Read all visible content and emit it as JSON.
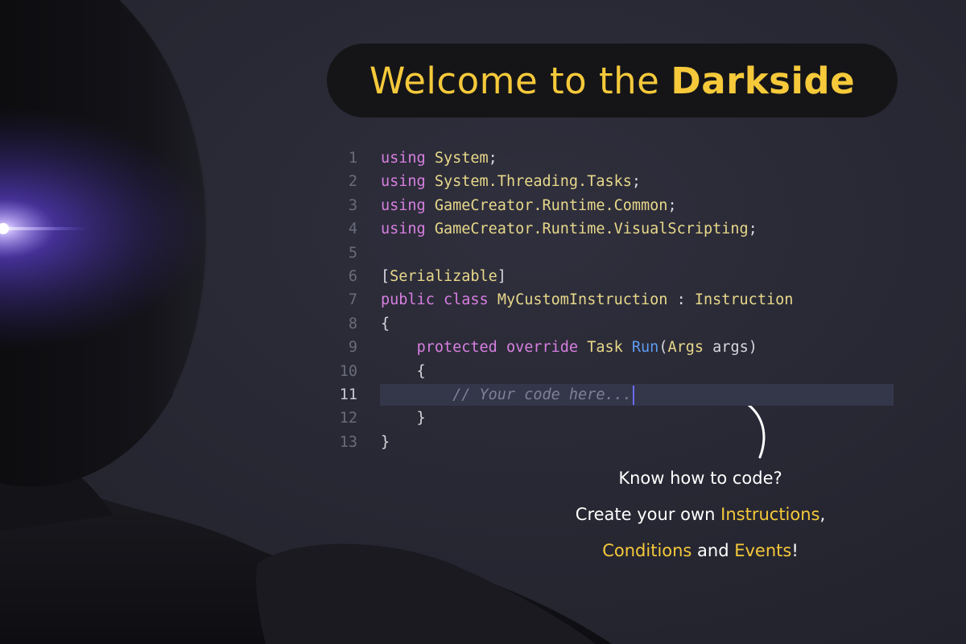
{
  "title": {
    "regular": "Welcome to the",
    "bold": "Darkside"
  },
  "code_lines": [
    {
      "n": "1",
      "parts": [
        [
          "k",
          "using"
        ],
        [
          "p",
          " "
        ],
        [
          "t",
          "System"
        ],
        [
          "p",
          ";"
        ]
      ]
    },
    {
      "n": "2",
      "parts": [
        [
          "k",
          "using"
        ],
        [
          "p",
          " "
        ],
        [
          "t",
          "System.Threading.Tasks"
        ],
        [
          "p",
          ";"
        ]
      ]
    },
    {
      "n": "3",
      "parts": [
        [
          "k",
          "using"
        ],
        [
          "p",
          " "
        ],
        [
          "t",
          "GameCreator.Runtime.Common"
        ],
        [
          "p",
          ";"
        ]
      ]
    },
    {
      "n": "4",
      "parts": [
        [
          "k",
          "using"
        ],
        [
          "p",
          " "
        ],
        [
          "t",
          "GameCreator.Runtime.VisualScripting"
        ],
        [
          "p",
          ";"
        ]
      ]
    },
    {
      "n": "5",
      "parts": []
    },
    {
      "n": "6",
      "parts": [
        [
          "p",
          "["
        ],
        [
          "t",
          "Serializable"
        ],
        [
          "p",
          "]"
        ]
      ]
    },
    {
      "n": "7",
      "parts": [
        [
          "k",
          "public"
        ],
        [
          "p",
          " "
        ],
        [
          "k",
          "class"
        ],
        [
          "p",
          " "
        ],
        [
          "t",
          "MyCustomInstruction"
        ],
        [
          "p",
          " : "
        ],
        [
          "t",
          "Instruction"
        ]
      ]
    },
    {
      "n": "8",
      "parts": [
        [
          "p",
          "{"
        ]
      ]
    },
    {
      "n": "9",
      "parts": [
        [
          "p",
          "    "
        ],
        [
          "k",
          "protected"
        ],
        [
          "p",
          " "
        ],
        [
          "k",
          "override"
        ],
        [
          "p",
          " "
        ],
        [
          "t",
          "Task"
        ],
        [
          "p",
          " "
        ],
        [
          "f",
          "Run"
        ],
        [
          "p",
          "("
        ],
        [
          "t",
          "Args"
        ],
        [
          "p",
          " args)"
        ]
      ]
    },
    {
      "n": "10",
      "parts": [
        [
          "p",
          "    {"
        ]
      ]
    },
    {
      "n": "11",
      "active": true,
      "parts": [
        [
          "p",
          "        "
        ],
        [
          "c",
          "// Your code here..."
        ]
      ]
    },
    {
      "n": "12",
      "parts": [
        [
          "p",
          "    }"
        ]
      ]
    },
    {
      "n": "13",
      "parts": [
        [
          "p",
          "}"
        ]
      ]
    }
  ],
  "caption": {
    "line1": "Know how to code?",
    "line2_prefix": "Create your own ",
    "line2_highlight": "Instructions",
    "line2_suffix": ",",
    "line3_highlight1": "Conditions",
    "line3_middle": " and ",
    "line3_highlight2": "Events",
    "line3_suffix": "!"
  },
  "colors": {
    "background": "#2a2a36",
    "title_accent": "#f5c93a",
    "keyword": "#d77fe0",
    "type": "#e8d88a",
    "method": "#5e9bf0",
    "comment": "#7e8296",
    "eye_glow": "#7a5cff"
  }
}
